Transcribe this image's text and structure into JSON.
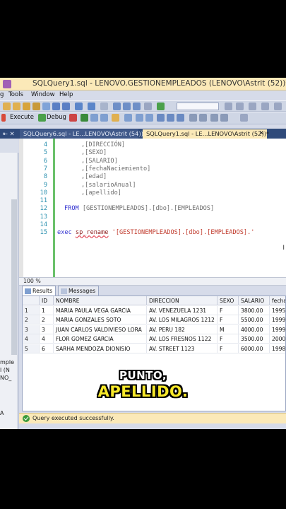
{
  "window": {
    "title": "SQLQuery1.sql - LENOVO.GESTIONEMPLEADOS (LENOVO\\Astrit (52))* - Micro"
  },
  "menu": [
    "g",
    "Tools",
    "Window",
    "Help"
  ],
  "toolbar2": {
    "execute_label": "Execute",
    "debug_label": "Debug"
  },
  "tabs": {
    "inactive": "SQLQuery6.sql - LE...LENOVO\\Astrit (54))",
    "active": "SQLQuery1.sql - LE...LENOVO\\Astrit (52))*",
    "close_glyph": "✕",
    "left_glyph": "⇤ ✕"
  },
  "left_panel": {
    "lines": [
      "mple",
      "l (N",
      "NO_",
      "A"
    ]
  },
  "editor": {
    "lines": [
      {
        "n": "4",
        "text": ",[DIRECCIÓN]"
      },
      {
        "n": "5",
        "text": ",[SEXO]"
      },
      {
        "n": "6",
        "text": ",[SALARIO]"
      },
      {
        "n": "7",
        "text": ",[fechaNaciemiento]"
      },
      {
        "n": "8",
        "text": ",[edad]"
      },
      {
        "n": "9",
        "text": ",[salarioAnual]"
      },
      {
        "n": "10",
        "text": ",[apellido]"
      },
      {
        "n": "11",
        "text": ""
      },
      {
        "n": "12",
        "kw": "FROM",
        "rest": " [GESTIONEMPLEADOS].[dbo].[EMPLEADOS]"
      },
      {
        "n": "13",
        "text": ""
      },
      {
        "n": "14",
        "text": ""
      },
      {
        "n": "15",
        "kw": "exec",
        "fn": "sp_rename",
        "str": "'[GESTIONEMPLEADOS].[dbo].[EMPLEADOS].'"
      }
    ],
    "cursor_glyph": "I"
  },
  "zoom": "100 %",
  "results_tabs": {
    "results": "Results",
    "messages": "Messages"
  },
  "grid": {
    "columns": [
      "ID",
      "NOMBRE",
      "DIRECCION",
      "SEXO",
      "SALARIO",
      "fecha"
    ],
    "rows": [
      [
        "1",
        "1",
        "MARIA PAULA VEGA GARCIA",
        "AV. VENEZUELA 1231",
        "F",
        "3800.00",
        "1995"
      ],
      [
        "2",
        "2",
        "MARIA GONZALES SOTO",
        "AV. LOS MILAGROS 1212",
        "F",
        "5500.00",
        "1999"
      ],
      [
        "3",
        "3",
        "JUAN CARLOS VALDIVIESO LORA",
        "AV. PERU 182",
        "M",
        "4000.00",
        "1999"
      ],
      [
        "4",
        "4",
        "FLOR GOMEZ GARCIA",
        "AV. LOS FRESNOS 1122",
        "F",
        "3500.00",
        "2000"
      ],
      [
        "5",
        "6",
        "SARHA MENDOZA DIONISIO",
        "AV. STREET 1123",
        "F",
        "6000.00",
        "1998"
      ]
    ]
  },
  "status": {
    "message": "Query executed successfully."
  },
  "caption": {
    "line1": "PUNTO,",
    "line2": "APELLIDO."
  },
  "colors": {
    "title_bar": "#fbe9b8",
    "tab_row": "#2f4a7a",
    "caption_highlight": "#f7e82a",
    "keyword": "#3030d0",
    "string": "#c0392b"
  }
}
